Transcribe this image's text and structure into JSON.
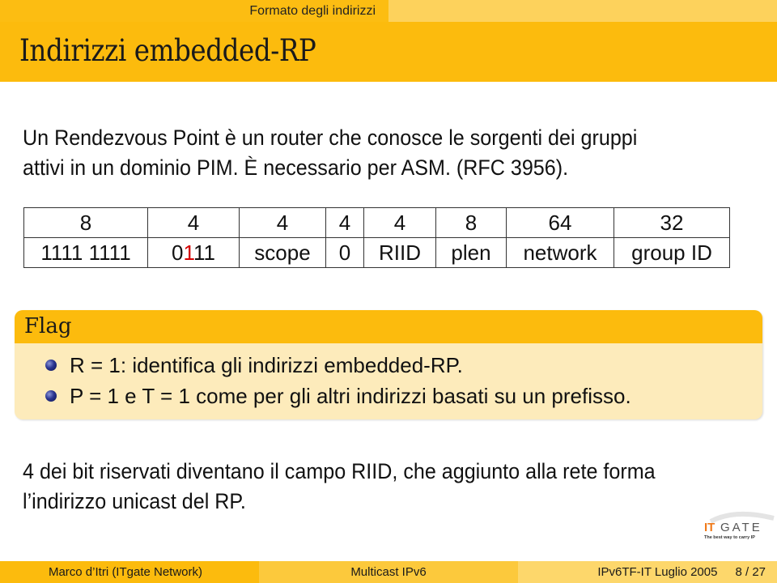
{
  "headline": {
    "section": "Formato degli indirizzi"
  },
  "frame": {
    "title": "Indirizzi embedded-RP"
  },
  "intro": {
    "lines": [
      "Un Rendezvous Point è un router che conosce le sorgenti dei gruppi",
      "attivi in un dominio PIM. È necessario per ASM. (RFC 3956)."
    ]
  },
  "address_table": {
    "bits": [
      "8",
      "4",
      "4",
      "4",
      "4",
      "8",
      "64",
      "32"
    ],
    "fields": [
      "1111 1111",
      "0111",
      "scope",
      "0",
      "RIID",
      "plen",
      "network",
      "group ID"
    ],
    "flags_field": {
      "prefix": "0",
      "highlight": "1",
      "suffix": "11",
      "highlight_color": "#d40000"
    }
  },
  "flag_block": {
    "title": "Flag",
    "items": [
      "R = 1: identifica gli indirizzi embedded-RP.",
      "P = 1 e T = 1 come per gli altri indirizzi basati su un prefisso."
    ]
  },
  "conclusion": {
    "lines": [
      "4 dei bit riservati diventano il campo RIID, che aggiunto alla rete forma",
      "l’indirizzo unicast del RP."
    ]
  },
  "logo": {
    "brand_it": "IT",
    "brand_gate": "GATE",
    "tagline": "The best way to carry IP",
    "accent_color": "#f07a1a"
  },
  "footer": {
    "author": "Marco d’Itri  (ITgate Network)",
    "talk": "Multicast IPv6",
    "event": "IPv6TF-IT Luglio 2005",
    "page": "8 / 27"
  },
  "colors": {
    "title_bar": "#fcbb0d",
    "block_body": "#fdebbb"
  }
}
